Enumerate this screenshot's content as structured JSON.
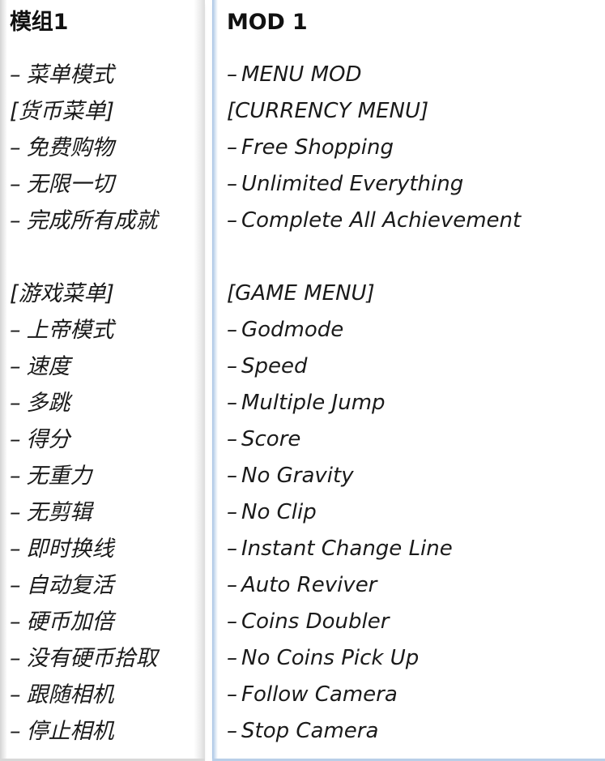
{
  "layout": {
    "columns": 2,
    "background": "#ffffff",
    "left_card_accent": "#d8d8d8",
    "right_card_accent": "#b9cfe8"
  },
  "columns": [
    {
      "id": "chinese",
      "title": "模组1",
      "lang": "zh",
      "items": [
        {
          "type": "dash",
          "dash": "–",
          "label": "菜单模式"
        },
        {
          "type": "bracket",
          "dash": "",
          "label": "[货币菜单]"
        },
        {
          "type": "dash",
          "dash": "–",
          "label": "免费购物"
        },
        {
          "type": "dash",
          "dash": "–",
          "label": "无限一切"
        },
        {
          "type": "dash",
          "dash": "–",
          "label": "完成所有成就"
        },
        {
          "type": "spacer",
          "dash": "",
          "label": ""
        },
        {
          "type": "bracket",
          "dash": "",
          "label": "[游戏菜单]"
        },
        {
          "type": "dash",
          "dash": "–",
          "label": "上帝模式"
        },
        {
          "type": "dash",
          "dash": "–",
          "label": "速度"
        },
        {
          "type": "dash",
          "dash": "–",
          "label": "多跳"
        },
        {
          "type": "dash",
          "dash": "–",
          "label": "得分"
        },
        {
          "type": "dash",
          "dash": "–",
          "label": "无重力"
        },
        {
          "type": "dash",
          "dash": "–",
          "label": "无剪辑"
        },
        {
          "type": "dash",
          "dash": "–",
          "label": "即时换线"
        },
        {
          "type": "dash",
          "dash": "–",
          "label": "自动复活"
        },
        {
          "type": "dash",
          "dash": "–",
          "label": "硬币加倍"
        },
        {
          "type": "dash",
          "dash": "–",
          "label": "没有硬币拾取"
        },
        {
          "type": "dash",
          "dash": "–",
          "label": "跟随相机"
        },
        {
          "type": "dash",
          "dash": "–",
          "label": "停止相机"
        }
      ]
    },
    {
      "id": "english",
      "title": "MOD 1",
      "lang": "en",
      "items": [
        {
          "type": "dash",
          "dash": "–",
          "label": "MENU MOD"
        },
        {
          "type": "bracket",
          "dash": "",
          "label": "[CURRENCY MENU]"
        },
        {
          "type": "dash",
          "dash": "–",
          "label": "Free Shopping"
        },
        {
          "type": "dash",
          "dash": "–",
          "label": "Unlimited Everything"
        },
        {
          "type": "dash",
          "dash": "–",
          "label": "Complete All Achievement"
        },
        {
          "type": "spacer",
          "dash": "",
          "label": ""
        },
        {
          "type": "bracket",
          "dash": "",
          "label": "[GAME MENU]"
        },
        {
          "type": "dash",
          "dash": "–",
          "label": "Godmode"
        },
        {
          "type": "dash",
          "dash": "–",
          "label": "Speed"
        },
        {
          "type": "dash",
          "dash": "–",
          "label": "Multiple Jump"
        },
        {
          "type": "dash",
          "dash": "–",
          "label": "Score"
        },
        {
          "type": "dash",
          "dash": "–",
          "label": "No Gravity"
        },
        {
          "type": "dash",
          "dash": "–",
          "label": "No Clip"
        },
        {
          "type": "dash",
          "dash": "–",
          "label": "Instant Change Line"
        },
        {
          "type": "dash",
          "dash": "–",
          "label": "Auto Reviver"
        },
        {
          "type": "dash",
          "dash": "–",
          "label": "Coins Doubler"
        },
        {
          "type": "dash",
          "dash": "–",
          "label": "No Coins Pick Up"
        },
        {
          "type": "dash",
          "dash": "–",
          "label": "Follow Camera"
        },
        {
          "type": "dash",
          "dash": "–",
          "label": "Stop Camera"
        }
      ]
    }
  ]
}
